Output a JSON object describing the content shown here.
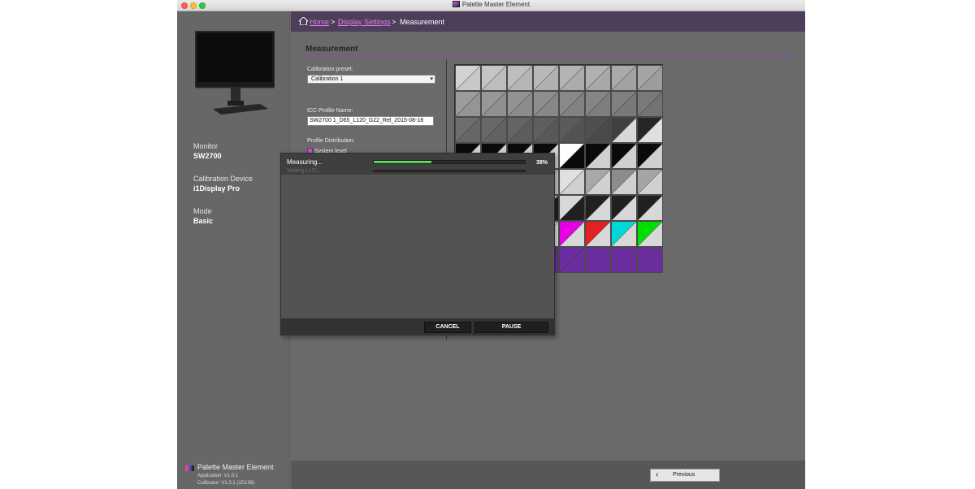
{
  "window": {
    "title": "Palette Master Element"
  },
  "breadcrumb": {
    "home": "Home",
    "display_settings": "Display Settings",
    "current": "Measurement",
    "separator": ">"
  },
  "sidebar": {
    "monitor_label": "Monitor",
    "monitor_value": "SW2700",
    "device_label": "Calibration Device",
    "device_value": "i1Display Pro",
    "mode_label": "Mode",
    "mode_value": "Basic",
    "footer": {
      "app_name": "Palette Master Element",
      "application_version": "Application: V1.0.1",
      "calibrator_version": "Calibrator: V1.3.1 (1D136)"
    }
  },
  "main": {
    "section_title": "Measurement",
    "calibration_preset_label": "Calibration preset:",
    "calibration_preset_value": "Calibration 1",
    "icc_profile_label": "ICC Profile Name:",
    "icc_profile_value": "SW2700 1_D65_L120_G22_Rel_2015-08-18",
    "profile_distribution_label": "Profile Distribution:",
    "system_level_label": "System level"
  },
  "patch_grid": {
    "columns": 8,
    "rows": [
      [
        [
          "#d2d2d2",
          "#c8c8c8"
        ],
        [
          "#c5c5c5",
          "#bdbdbd"
        ],
        [
          "#bebebe",
          "#b6b6b6"
        ],
        [
          "#b9b9b9",
          "#b1b1b1"
        ],
        [
          "#b4b4b4",
          "#acacac"
        ],
        [
          "#b0b0b0",
          "#a8a8a8"
        ],
        [
          "#aaaaaa",
          "#a2a2a2"
        ],
        [
          "#a5a5a5",
          "#9d9d9d"
        ]
      ],
      [
        [
          "#9c9c9c",
          "#959595"
        ],
        [
          "#979797",
          "#909090"
        ],
        [
          "#939393",
          "#8c8c8c"
        ],
        [
          "#8e8e8e",
          "#878787"
        ],
        [
          "#898989",
          "#828282"
        ],
        [
          "#858585",
          "#7e7e7e"
        ],
        [
          "#808080",
          "#797979"
        ],
        [
          "#7a7a7a",
          "#737373"
        ]
      ],
      [
        [
          "#6e6e6e",
          "#676767"
        ],
        [
          "#696969",
          "#626262"
        ],
        [
          "#646464",
          "#5d5d5d"
        ],
        [
          "#5f5f5f",
          "#585858"
        ],
        [
          "#5a5a5a",
          "#535353"
        ],
        [
          "#4f4f4f",
          "#4a4a4a"
        ],
        [
          "#404040",
          "#d8d8d8"
        ],
        [
          "#262626",
          "#e0e0e0"
        ]
      ],
      [
        [
          "#0a0a0a",
          "#d0d0d0"
        ],
        [
          "#0a0a0a",
          "#d0d0d0"
        ],
        [
          "#0a0a0a",
          "#d0d0d0"
        ],
        [
          "#0a0a0a",
          "#d0d0d0"
        ],
        [
          "#ffffff",
          "#0a0a0a"
        ],
        [
          "#0a0a0a",
          "#d0d0d0"
        ],
        [
          "#0a0a0a",
          "#d0d0d0"
        ],
        [
          "#0a0a0a",
          "#d0d0d0"
        ]
      ],
      [
        [
          "#d8d8d8",
          "#c8c8c8"
        ],
        [
          "#d8d8d8",
          "#c8c8c8"
        ],
        [
          "#d8d8d8",
          "#c8c8c8"
        ],
        [
          "#d8d8d8",
          "#c8c8c8"
        ],
        [
          "#e0e0e0",
          "#d0d0d0"
        ],
        [
          "#a8a8a8",
          "#d0d0d0"
        ],
        [
          "#8c8c8c",
          "#d0d0d0"
        ],
        [
          "#a5a5a5",
          "#d0d0d0"
        ]
      ],
      [
        [
          "#d8d8d8",
          "#202020"
        ],
        [
          "#d8d8d8",
          "#202020"
        ],
        [
          "#d8d8d8",
          "#202020"
        ],
        [
          "#d8d8d8",
          "#202020"
        ],
        [
          "#d8d8d8",
          "#202020"
        ],
        [
          "#202020",
          "#d8d8d8"
        ],
        [
          "#202020",
          "#d8d8d8"
        ],
        [
          "#202020",
          "#d8d8d8"
        ]
      ],
      [
        [
          "#e0e0e0",
          "#e0e0e0"
        ],
        [
          "#e0e0e0",
          "#e0e0e0"
        ],
        [
          "#e0e0e0",
          "#e0e0e0"
        ],
        [
          "#e0e0e0",
          "#e0e0e0"
        ],
        [
          "#e600e6",
          "#d8d8d8"
        ],
        [
          "#e52020",
          "#d8d8d8"
        ],
        [
          "#00d8d8",
          "#d8d8d8"
        ],
        [
          "#00e000",
          "#d8d8d8"
        ]
      ],
      [
        [
          "#6a2ea0",
          "#6a2ea0"
        ],
        [
          "#6a2ea0",
          "#6a2ea0"
        ],
        [
          "#6a2ea0",
          "#6a2ea0"
        ],
        [
          "#6a2ea0",
          "#6a2ea0"
        ],
        [
          "#6a2ea0",
          "#6a2ea0"
        ],
        [
          "#6a2ea0",
          "#6a2ea0"
        ],
        [
          "#6a2ea0",
          "#6a2ea0"
        ],
        [
          "#6a2ea0",
          "#6a2ea0"
        ]
      ]
    ]
  },
  "dialog": {
    "status": "Measuring...",
    "substatus": "Writing LUT...",
    "progress_percent_value": 38,
    "progress_text": "38%",
    "cancel_label": "CANCEL",
    "pause_label": "PAUSE"
  },
  "footer": {
    "previous_label": "Previous"
  },
  "colors": {
    "accent_purple": "#8a4bb8",
    "link_pink": "#e47fe4",
    "progress_green": "#2fbf2f",
    "breadcrumb_bg": "#4d3f5a"
  }
}
